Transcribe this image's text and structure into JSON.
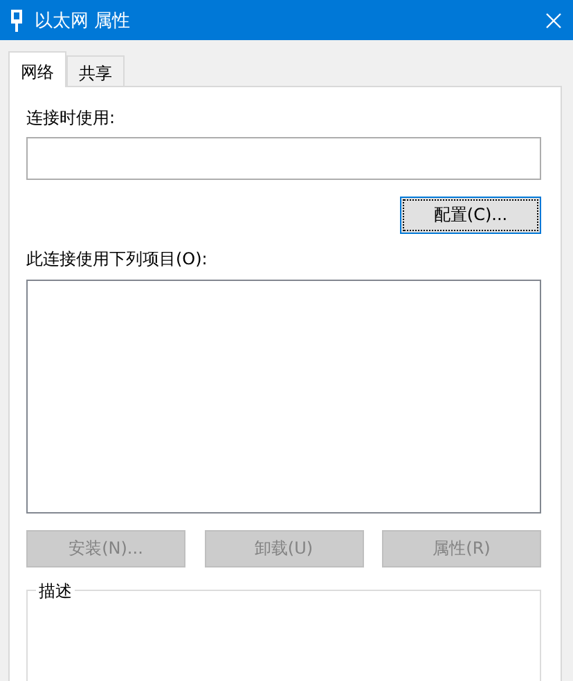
{
  "window": {
    "title": "以太网 属性"
  },
  "tabs": [
    {
      "label": "网络",
      "selected": true
    },
    {
      "label": "共享",
      "selected": false
    }
  ],
  "connect_using": {
    "label": "连接时使用:"
  },
  "configure_button": {
    "label": "配置(C)...",
    "focused": true
  },
  "items_label": "此连接使用下列项目(O):",
  "buttons": [
    {
      "label": "安装(N)...",
      "disabled": true
    },
    {
      "label": "卸载(U)",
      "disabled": true
    },
    {
      "label": "属性(R)",
      "disabled": true
    }
  ],
  "description": {
    "title": "描述"
  }
}
